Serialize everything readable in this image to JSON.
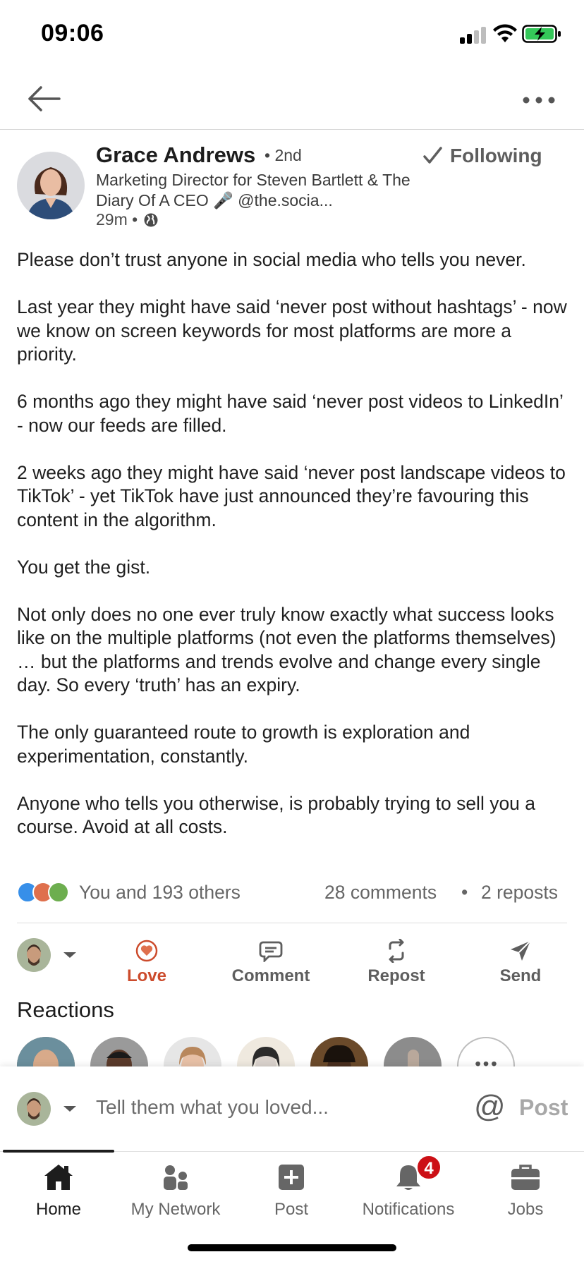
{
  "status_bar": {
    "time": "09:06"
  },
  "post": {
    "author": {
      "name": "Grace Andrews",
      "degree": "• 2nd",
      "headline": "Marketing Director for Steven Bartlett & The Diary Of A CEO 🎤 @the.socia...",
      "time": "29m •",
      "visibility_icon": "globe-icon"
    },
    "following_label": "Following",
    "paragraphs": [
      "Please don’t trust anyone in social media who tells you never.",
      "Last year they might have said ‘never post without hashtags’ - now we know on screen keywords for most platforms are more a priority.",
      "6 months ago they might have said ‘never post videos to LinkedIn’ - now our feeds are filled.",
      "2 weeks ago they might have said ‘never post landscape videos to TikTok’ - yet TikTok have just announced they’re favouring this content in the algorithm.",
      "You get the gist.",
      "Not only does no one ever truly know exactly what success looks like on the multiple platforms (not even the platforms themselves) … but the platforms and trends evolve and change every single day. So every ‘truth’ has an expiry.",
      "The only guaranteed route to growth is exploration and experimentation, constantly.",
      "Anyone who tells you otherwise, is probably trying to sell you a course. Avoid at all costs."
    ],
    "social": {
      "reactors": "You and 193 others",
      "comments": "28 comments",
      "separator": "•",
      "reposts": "2 reposts"
    }
  },
  "actions": {
    "love": "Love",
    "comment": "Comment",
    "repost": "Repost",
    "send": "Send"
  },
  "reactions_section": {
    "title": "Reactions",
    "more": "..."
  },
  "composer": {
    "placeholder": "Tell them what you loved...",
    "mention": "@",
    "post": "Post"
  },
  "tabs": [
    {
      "label": "Home",
      "icon": "home-icon"
    },
    {
      "label": "My Network",
      "icon": "network-icon"
    },
    {
      "label": "Post",
      "icon": "post-icon"
    },
    {
      "label": "Notifications",
      "icon": "bell-icon",
      "badge": "4"
    },
    {
      "label": "Jobs",
      "icon": "briefcase-icon"
    }
  ],
  "colors": {
    "love": "#cc4b2c",
    "like": "#378fe9",
    "support": "#44712e",
    "badge": "#cc1016",
    "battery": "#34c759"
  }
}
